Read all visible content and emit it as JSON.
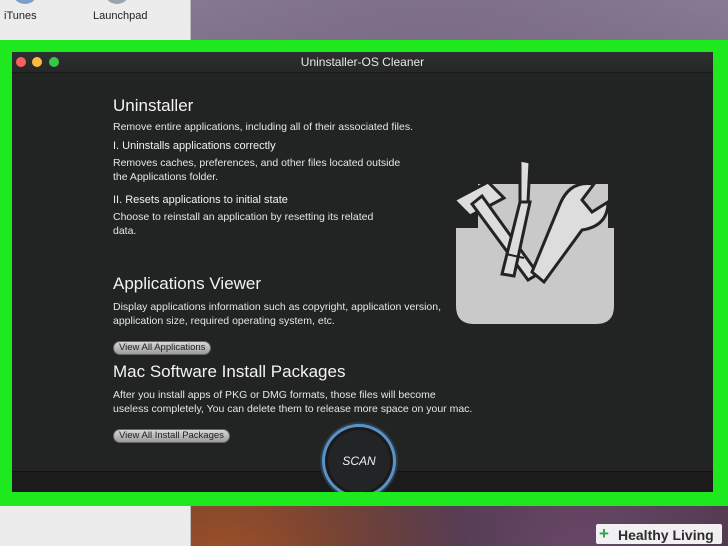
{
  "desktop": {
    "dock_labels": [
      "iTunes",
      "Launchpad"
    ]
  },
  "window": {
    "title": "Uninstaller-OS Cleaner"
  },
  "uninstaller": {
    "heading": "Uninstaller",
    "description": "Remove entire applications, including all of their associated files.",
    "item1_title": "I. Uninstalls applications correctly",
    "item1_desc": "Removes caches, preferences, and other files located outside the Applications folder.",
    "item2_title": "II. Resets applications to initial state",
    "item2_desc": "Choose to reinstall an application by resetting its related data."
  },
  "applications_viewer": {
    "heading": "Applications Viewer",
    "description": "Display applications information such as copyright, application version, application size, required operating system, etc.",
    "button_label": "View All Applications"
  },
  "packages": {
    "heading": "Mac Software Install Packages",
    "description": "After you install apps of PKG or DMG formats, those files will become useless completely, You can delete them to release more space on your mac.",
    "button_label": "View All Install Packages"
  },
  "scan": {
    "label": "SCAN"
  },
  "watermark": {
    "text": "Healthy Living"
  },
  "colors": {
    "highlight": "#1ee81e",
    "window_bg": "#222323",
    "scan_ring": "#5a92c6"
  },
  "icons": [
    "toolbox-icon",
    "hammer-icon",
    "screwdriver-icon",
    "wrench-icon",
    "plus-icon"
  ]
}
